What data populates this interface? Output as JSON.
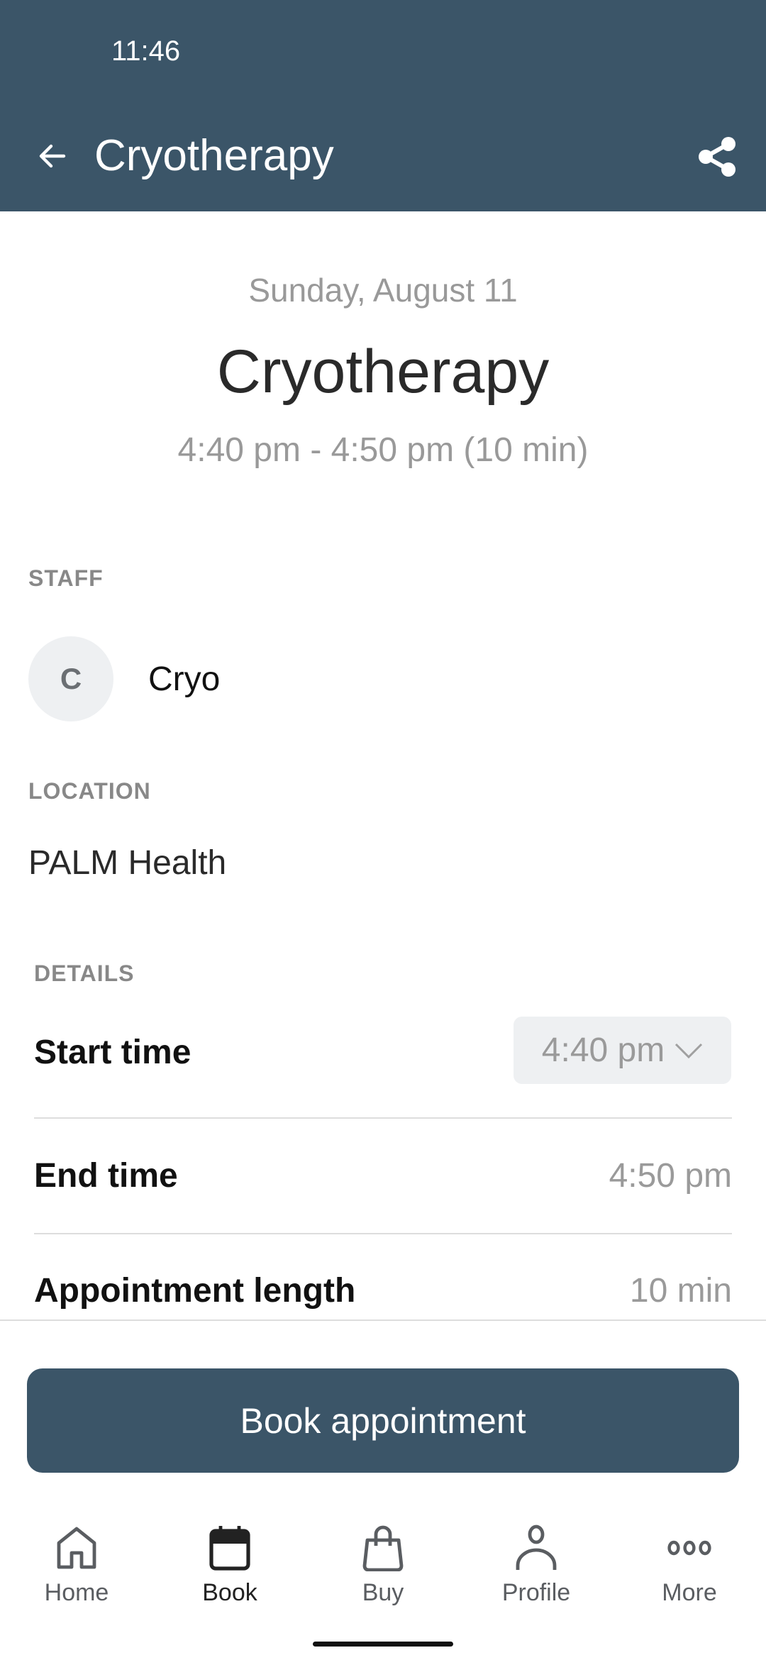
{
  "status_bar": {
    "time": "11:46"
  },
  "header": {
    "title": "Cryotherapy",
    "back_icon": "arrow-left-icon",
    "share_icon": "share-icon"
  },
  "summary": {
    "date": "Sunday, August 11",
    "title": "Cryotherapy",
    "time_range": "4:40 pm - 4:50 pm (10 min)"
  },
  "staff": {
    "label": "STAFF",
    "avatar_initial": "C",
    "name": "Cryo"
  },
  "location": {
    "label": "LOCATION",
    "name": "PALM Health"
  },
  "details": {
    "label": "DETAILS",
    "start_time": {
      "label": "Start time",
      "value": "4:40 pm"
    },
    "end_time": {
      "label": "End time",
      "value": "4:50 pm"
    },
    "length": {
      "label": "Appointment length",
      "value": "10 min"
    }
  },
  "book_button": {
    "label": "Book appointment"
  },
  "colors": {
    "brand": "#3b5568",
    "muted_text": "#999999",
    "chip_bg": "#eef0f2"
  },
  "nav": {
    "items": [
      {
        "label": "Home",
        "icon": "home-icon",
        "active": false
      },
      {
        "label": "Book",
        "icon": "calendar-icon",
        "active": true
      },
      {
        "label": "Buy",
        "icon": "shopping-bag-icon",
        "active": false
      },
      {
        "label": "Profile",
        "icon": "person-icon",
        "active": false
      },
      {
        "label": "More",
        "icon": "more-dots-icon",
        "active": false
      }
    ]
  }
}
